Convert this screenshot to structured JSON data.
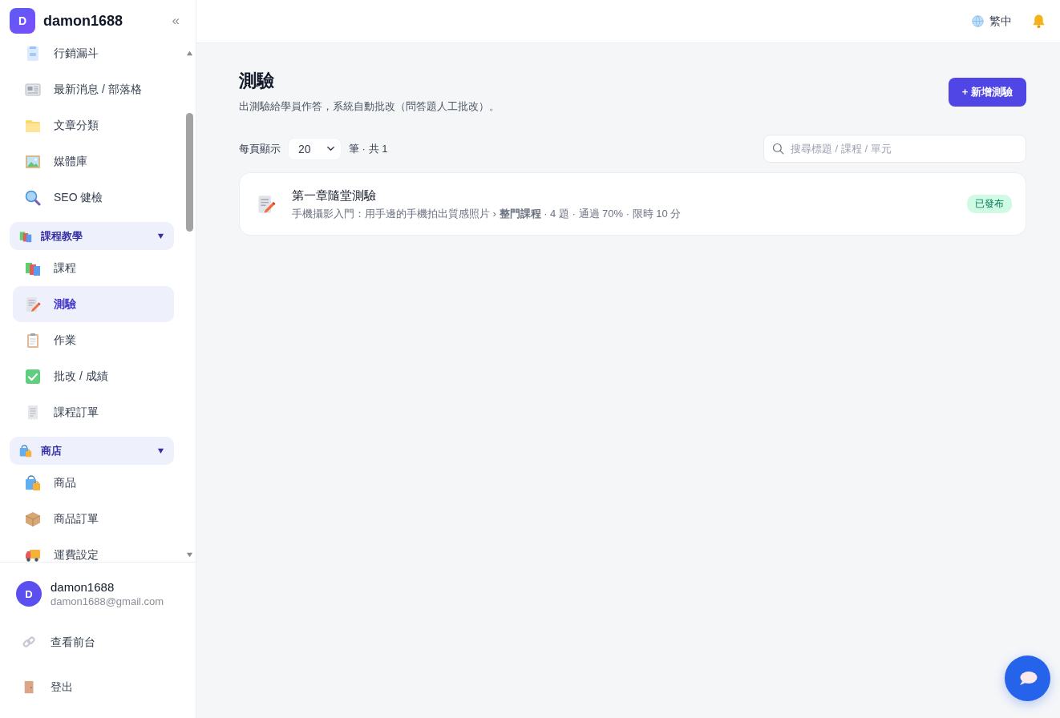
{
  "sidebar": {
    "brand": {
      "initial": "D",
      "name": "damon1688"
    },
    "collapse": "«",
    "nav": [
      {
        "kind": "link",
        "label": "行銷漏斗",
        "selected": false
      },
      {
        "kind": "link",
        "label": "最新消息 / 部落格",
        "selected": false
      },
      {
        "kind": "link",
        "label": "文章分類",
        "selected": false
      },
      {
        "kind": "link",
        "label": "媒體庫",
        "selected": false
      },
      {
        "kind": "link",
        "label": "SEO 健檢",
        "selected": false
      },
      {
        "kind": "group",
        "label": "課程教學",
        "expanded": true,
        "children": [
          {
            "label": "課程",
            "selected": false
          },
          {
            "label": "測驗",
            "selected": true
          },
          {
            "label": "作業",
            "selected": false
          },
          {
            "label": "批改 / 成績",
            "selected": false
          },
          {
            "label": "課程訂單",
            "selected": false
          }
        ]
      },
      {
        "kind": "group",
        "label": "商店",
        "expanded": true,
        "children": [
          {
            "label": "商品",
            "selected": false
          },
          {
            "label": "商品訂單",
            "selected": false
          },
          {
            "label": "運費設定",
            "selected": false
          }
        ]
      }
    ],
    "user": {
      "initial": "D",
      "name": "damon1688",
      "email": "damon1688@gmail.com"
    },
    "footer_links": [
      "查看前台",
      "登出"
    ]
  },
  "topbar": {
    "language": "繁中"
  },
  "page": {
    "title": "測驗",
    "subtitle": "出測驗給學員作答，系統自動批改（問答題人工批改）。",
    "new_button": "+ 新增測驗"
  },
  "toolbar": {
    "per_page_label": "每頁顯示",
    "per_page": "20",
    "count": "筆 · 共 1",
    "search": {
      "placeholder": "搜尋標題 / 課程 / 單元"
    }
  },
  "quizzes": [
    {
      "title": "第一章隨堂測驗",
      "meta": "手機攝影入門：用手邊的手機拍出質感照片 › **整門課程** · 4 題 · 通過 70% · 限時 10 分",
      "status": "已發布"
    }
  ]
}
